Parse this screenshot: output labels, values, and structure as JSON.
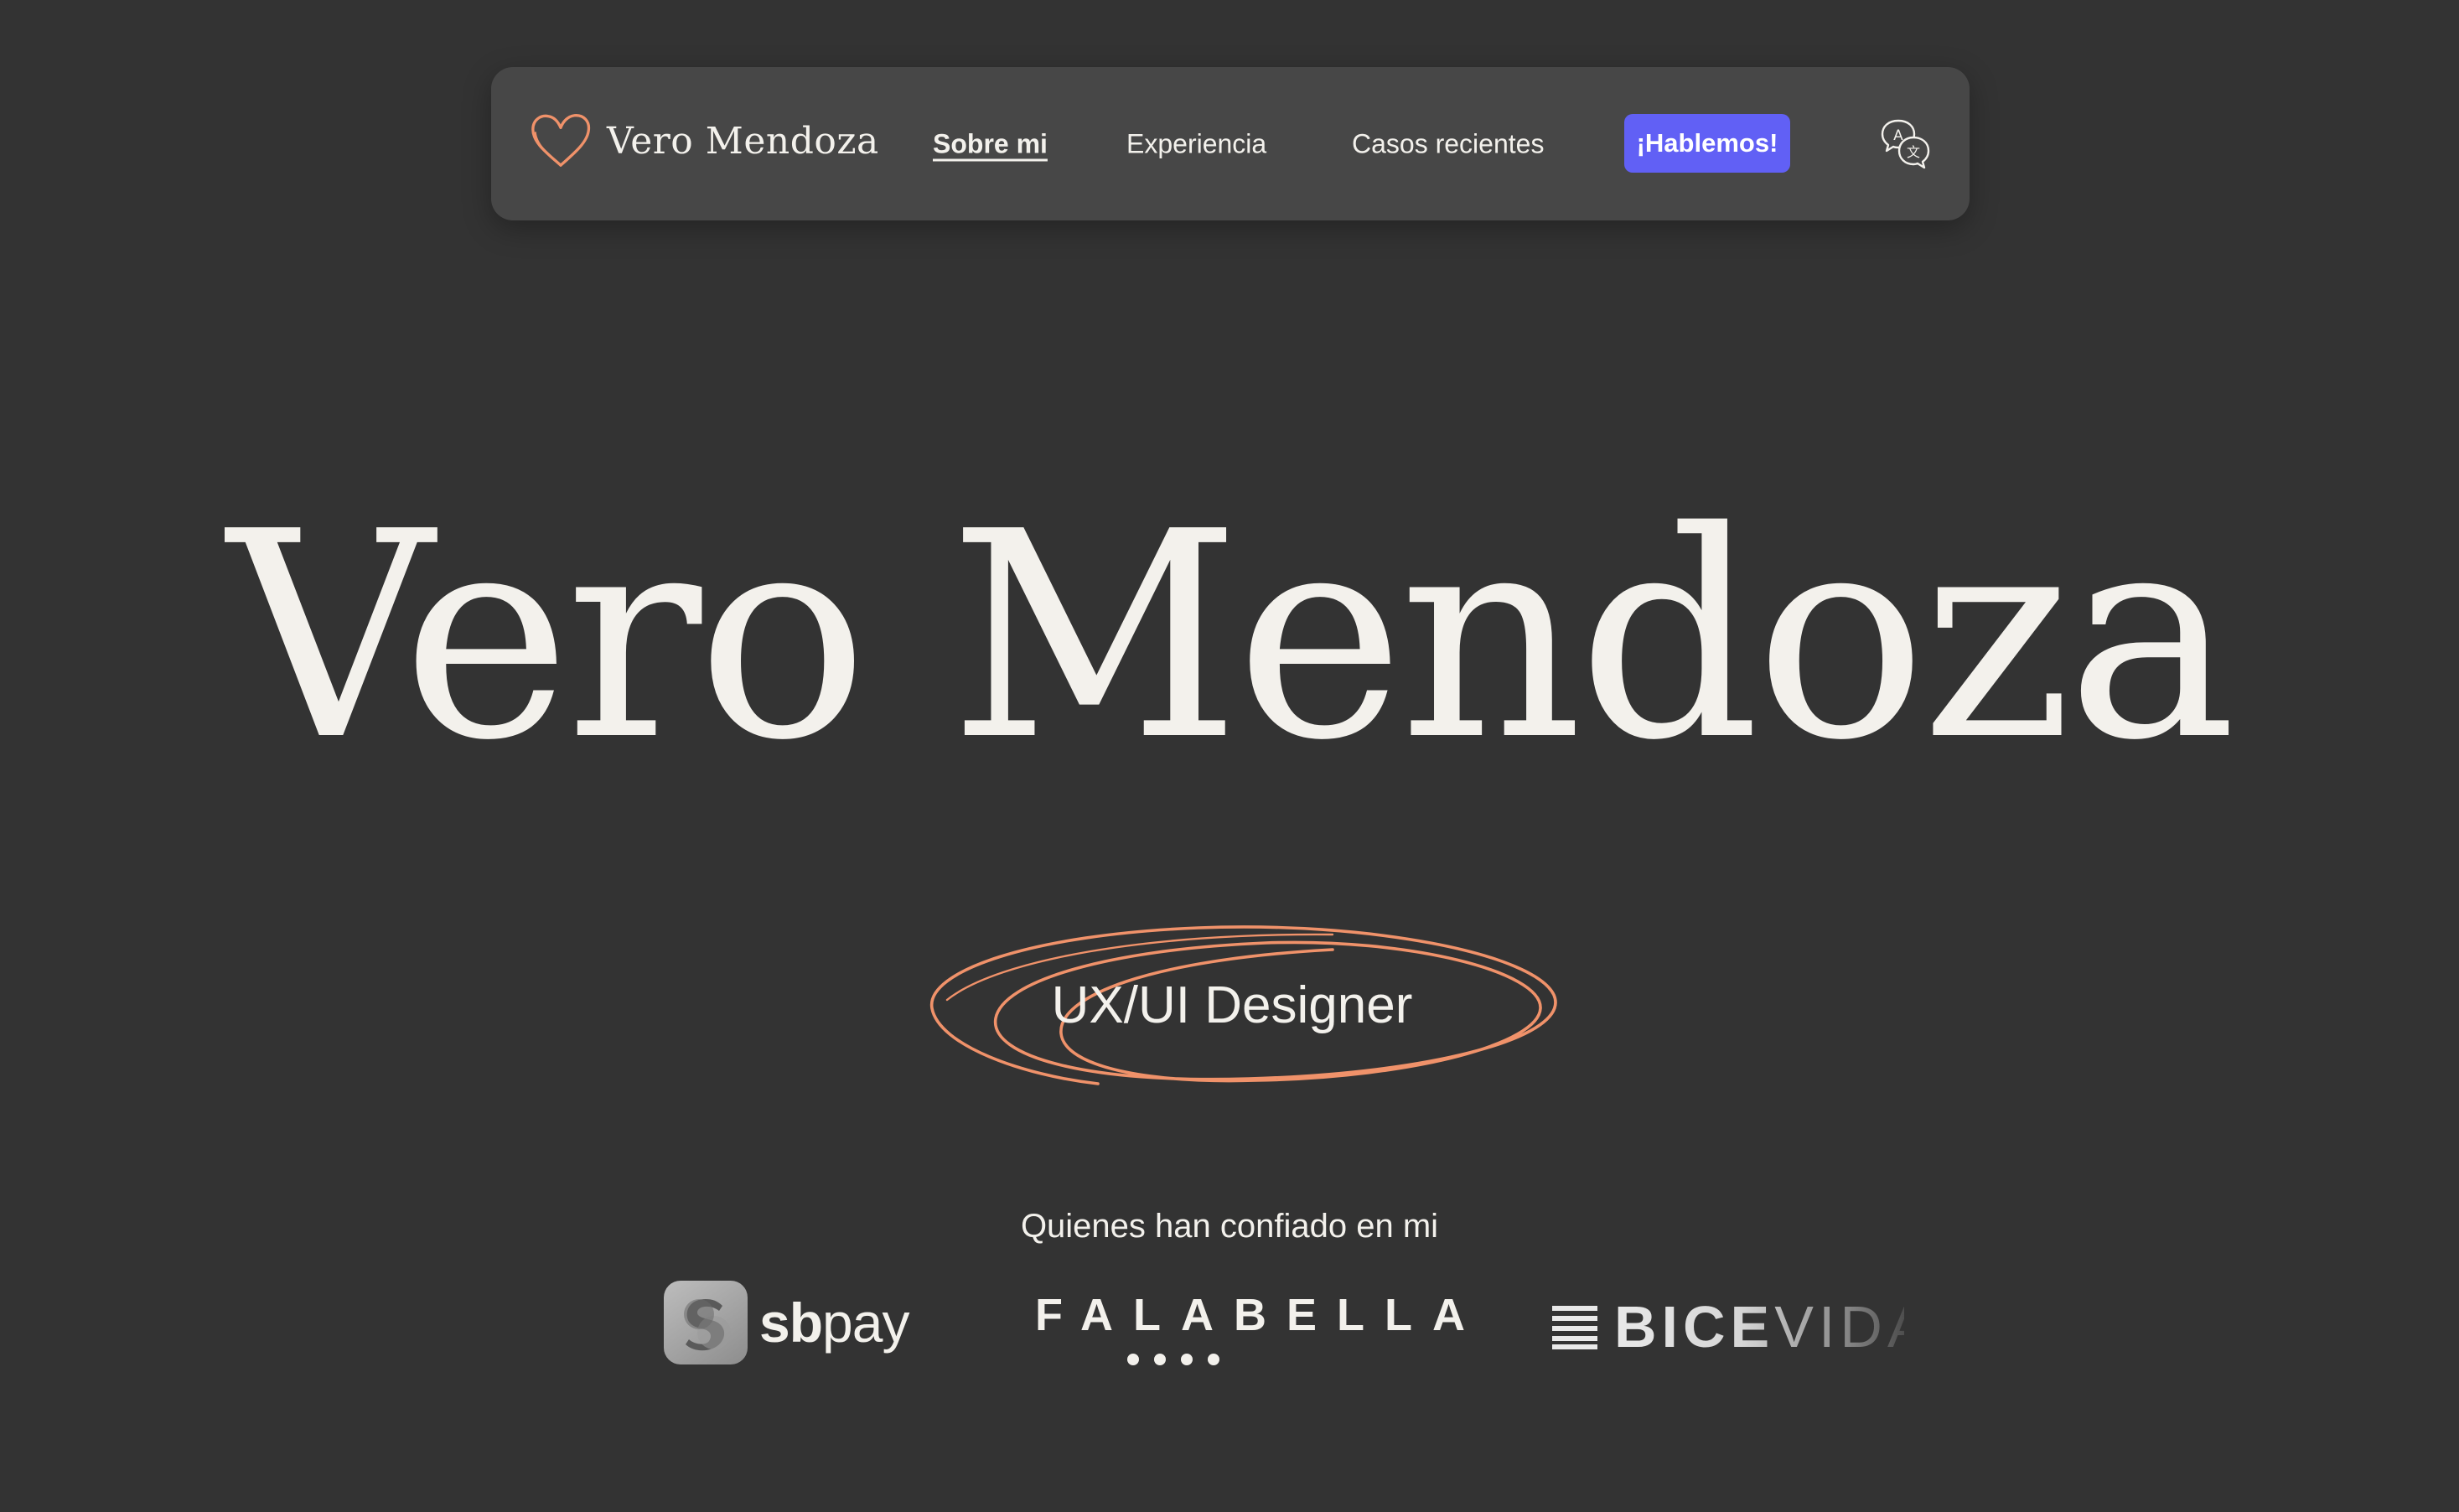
{
  "nav": {
    "brand_name": "Vero Mendoza",
    "links": [
      {
        "label": "Sobre mi",
        "active": true
      },
      {
        "label": "Experiencia",
        "active": false
      },
      {
        "label": "Casos recientes",
        "active": false
      }
    ],
    "cta_label": "¡Hablemos!",
    "language_icon": "translate-icon"
  },
  "hero": {
    "name": "Vero Mendoza",
    "role": "UX/UI Designer"
  },
  "trust": {
    "title": "Quienes han confiado en mi",
    "logos": {
      "sbpay": {
        "bold": "sb",
        "regular": "pay"
      },
      "falabella": "FALABELLA",
      "bicevida": {
        "bold": "BICE",
        "regular": "VIDA"
      }
    }
  },
  "colors": {
    "background": "#333333",
    "navbar": "#474747",
    "accent": "#f0926a",
    "cta": "#6160f5",
    "text": "#f3f1ec"
  }
}
